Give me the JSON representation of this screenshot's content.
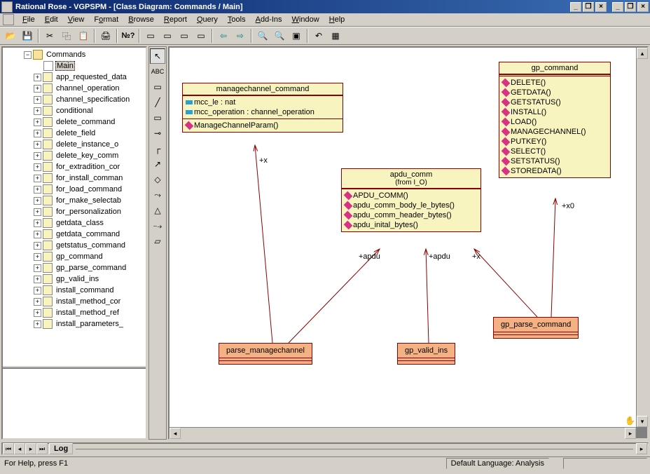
{
  "title": "Rational Rose - VGPSPM - [Class Diagram: Commands / Main]",
  "menu": [
    "File",
    "Edit",
    "View",
    "Format",
    "Browse",
    "Report",
    "Query",
    "Tools",
    "Add-Ins",
    "Window",
    "Help"
  ],
  "toolbar_icons": [
    "open-icon",
    "save-icon",
    "sep",
    "cut-icon",
    "copy-icon",
    "paste-icon",
    "sep",
    "print-icon",
    "sep",
    "help-icon",
    "sep",
    "browse-class-icon",
    "browse-obj-icon",
    "browse-comp-icon",
    "browse-depl-icon",
    "sep",
    "back-icon",
    "forward-icon",
    "sep",
    "zoom-in-icon",
    "zoom-out-icon",
    "fit-icon",
    "sep",
    "undo-icon",
    "spec-icon"
  ],
  "toolbox_icons": [
    "pointer-icon",
    "text-icon",
    "note-icon",
    "anchor-icon",
    "class-icon",
    "interface-icon",
    "assoc-icon",
    "aggr-icon",
    "link-icon",
    "dep-icon",
    "gen-icon",
    "real-icon",
    "package-icon"
  ],
  "tree": {
    "root": {
      "label": "Commands",
      "expanded": true
    },
    "selected": "Main",
    "items": [
      {
        "label": "Main",
        "icon": "diagram"
      },
      {
        "label": "app_requested_data",
        "icon": "class"
      },
      {
        "label": "channel_operation",
        "icon": "class"
      },
      {
        "label": "channel_specification",
        "icon": "class"
      },
      {
        "label": "conditional",
        "icon": "class"
      },
      {
        "label": "delete_command",
        "icon": "class"
      },
      {
        "label": "delete_field",
        "icon": "class"
      },
      {
        "label": "delete_instance_o",
        "icon": "class"
      },
      {
        "label": "delete_key_comm",
        "icon": "class"
      },
      {
        "label": "for_extradition_cor",
        "icon": "class"
      },
      {
        "label": "for_install_comman",
        "icon": "class"
      },
      {
        "label": "for_load_command",
        "icon": "class"
      },
      {
        "label": "for_make_selectab",
        "icon": "class"
      },
      {
        "label": "for_personalization",
        "icon": "class"
      },
      {
        "label": "getdata_class",
        "icon": "class"
      },
      {
        "label": "getdata_command",
        "icon": "class"
      },
      {
        "label": "getstatus_command",
        "icon": "class"
      },
      {
        "label": "gp_command",
        "icon": "class"
      },
      {
        "label": "gp_parse_command",
        "icon": "class"
      },
      {
        "label": "gp_valid_ins",
        "icon": "class"
      },
      {
        "label": "install_command",
        "icon": "class"
      },
      {
        "label": "install_method_cor",
        "icon": "class"
      },
      {
        "label": "install_method_ref",
        "icon": "class"
      },
      {
        "label": "install_parameters_",
        "icon": "class"
      }
    ]
  },
  "classes": {
    "mcc": {
      "name": "managechannel_command",
      "attrs": [
        {
          "name": "mcc_le : nat"
        },
        {
          "name": "mcc_operation : channel_operation"
        }
      ],
      "ops": [
        {
          "name": "ManageChannelParam()"
        }
      ]
    },
    "apdu": {
      "name": "apdu_comm",
      "from": "(from I_O)",
      "ops": [
        {
          "name": "APDU_COMM()"
        },
        {
          "name": "apdu_comm_body_le_bytes()"
        },
        {
          "name": "apdu_comm_header_bytes()"
        },
        {
          "name": "apdu_inital_bytes()"
        }
      ]
    },
    "gp": {
      "name": "gp_command",
      "ops": [
        {
          "name": "DELETE()"
        },
        {
          "name": "GETDATA()"
        },
        {
          "name": "GETSTATUS()"
        },
        {
          "name": "INSTALL()"
        },
        {
          "name": "LOAD()"
        },
        {
          "name": "MANAGECHANNEL()"
        },
        {
          "name": "PUTKEY()"
        },
        {
          "name": "SELECT()"
        },
        {
          "name": "SETSTATUS()"
        },
        {
          "name": "STOREDATA()"
        }
      ]
    }
  },
  "tables": {
    "parse_mc": {
      "name": "parse_managechannel"
    },
    "valid_ins": {
      "name": "gp_valid_ins"
    },
    "parse_cmd": {
      "name": "gp_parse_command"
    }
  },
  "labels": {
    "x": "+x",
    "apdu_l": "+apdu",
    "apdu_r": "+apdu",
    "x2": "+x",
    "x0": "+x0"
  },
  "log_tab": "Log",
  "status": {
    "help": "For Help, press F1",
    "lang": "Default Language: Analysis"
  }
}
